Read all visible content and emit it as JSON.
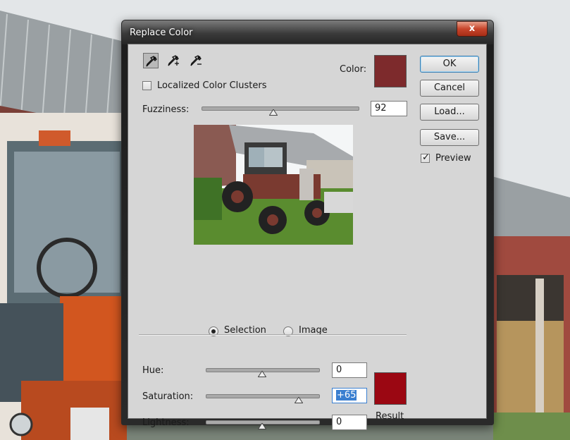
{
  "window": {
    "title": "Replace Color",
    "close_glyph": "x"
  },
  "tools": [
    {
      "icon": "eyedropper-icon",
      "selected": true
    },
    {
      "icon": "eyedropper-plus-icon",
      "selected": false
    },
    {
      "icon": "eyedropper-minus-icon",
      "selected": false
    }
  ],
  "localized": {
    "label": "Localized Color Clusters",
    "checked": false
  },
  "color": {
    "label": "Color:",
    "value": "#7d2a2c"
  },
  "fuzziness": {
    "label": "Fuzziness:",
    "value": "92",
    "fraction": 0.46
  },
  "view": {
    "selection_label": "Selection",
    "image_label": "Image",
    "selected": "selection"
  },
  "hue": {
    "label": "Hue:",
    "value": "0",
    "fraction": 0.5
  },
  "saturation": {
    "label": "Saturation:",
    "value": "+65",
    "fraction": 0.825
  },
  "lightness": {
    "label": "Lightness:",
    "value": "0",
    "fraction": 0.5
  },
  "result": {
    "label": "Result",
    "color": "#9b0712"
  },
  "buttons": {
    "ok": "OK",
    "cancel": "Cancel",
    "load": "Load...",
    "save": "Save..."
  },
  "preview": {
    "label": "Preview",
    "checked": true
  }
}
